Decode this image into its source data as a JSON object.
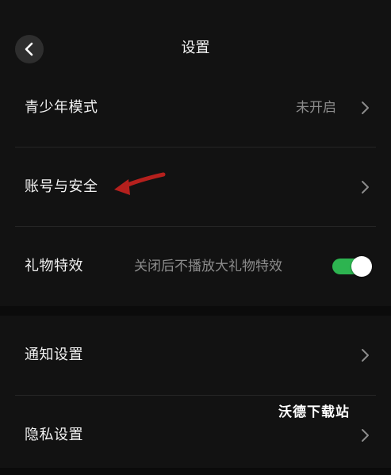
{
  "header": {
    "title": "设置"
  },
  "rows": [
    {
      "label": "青少年模式",
      "value": "未开启"
    },
    {
      "label": "账号与安全"
    },
    {
      "label": "礼物特效",
      "description": "关闭后不播放大礼物特效",
      "toggle_on": true
    }
  ],
  "rows2": [
    {
      "label": "通知设置"
    },
    {
      "label": "隐私设置"
    }
  ],
  "colors": {
    "background": "#0b0b0b",
    "surface": "#121212",
    "toggle_on": "#2db450",
    "annotation_arrow": "#b5201d"
  },
  "annotation": {
    "watermark": "沃德下载站"
  }
}
